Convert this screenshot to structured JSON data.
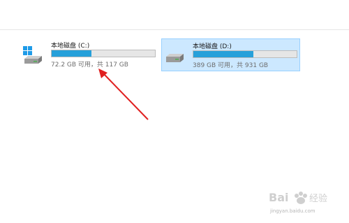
{
  "drives": [
    {
      "name": "本地磁盘 (C:)",
      "space": "72.2 GB 可用，共 117 GB",
      "used_fraction": 0.383,
      "has_windows_logo": true,
      "selected": false
    },
    {
      "name": "本地磁盘 (D:)",
      "space": "389 GB 可用，共 931 GB",
      "used_fraction": 0.582,
      "has_windows_logo": false,
      "selected": true
    }
  ],
  "annotation": {
    "arrow_color": "#e02020",
    "icon": "red-arrow-icon"
  },
  "watermark": {
    "text": "jingyan.baidu.com",
    "logo": "baidu-jingyan-logo"
  },
  "colors": {
    "bar_fill": "#26a0da",
    "selection_bg": "#cce8ff",
    "selection_border": "#99d1ff"
  }
}
